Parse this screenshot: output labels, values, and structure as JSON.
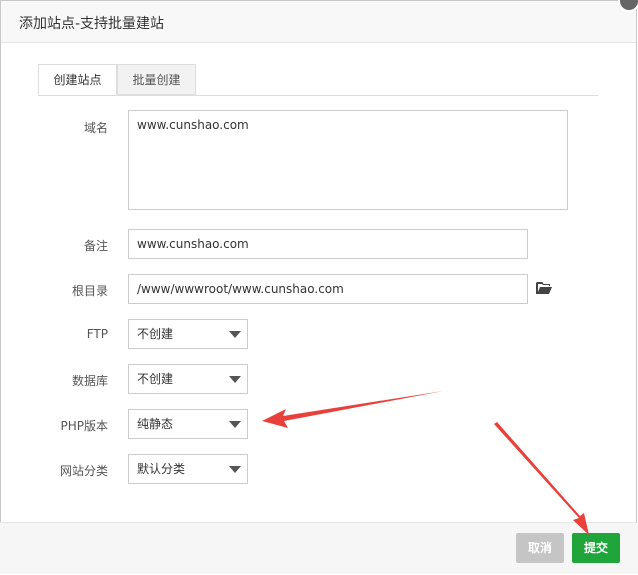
{
  "dialog": {
    "title": "添加站点-支持批量建站"
  },
  "tabs": [
    {
      "label": "创建站点"
    },
    {
      "label": "批量创建"
    }
  ],
  "form": {
    "domain": {
      "label": "域名",
      "value": "www.cunshao.com"
    },
    "remark": {
      "label": "备注",
      "value": "www.cunshao.com"
    },
    "root": {
      "label": "根目录",
      "value": "/www/wwwroot/www.cunshao.com"
    },
    "ftp": {
      "label": "FTP",
      "value": "不创建"
    },
    "database": {
      "label": "数据库",
      "value": "不创建"
    },
    "php": {
      "label": "PHP版本",
      "value": "纯静态"
    },
    "category": {
      "label": "网站分类",
      "value": "默认分类"
    }
  },
  "buttons": {
    "cancel": "取消",
    "submit": "提交"
  },
  "colors": {
    "submit": "#20a53a",
    "cancel": "#c5c5c5",
    "annotation_arrow": "#e8413c"
  },
  "icons": {
    "folder": "folder-open-icon",
    "close": "close-icon"
  }
}
